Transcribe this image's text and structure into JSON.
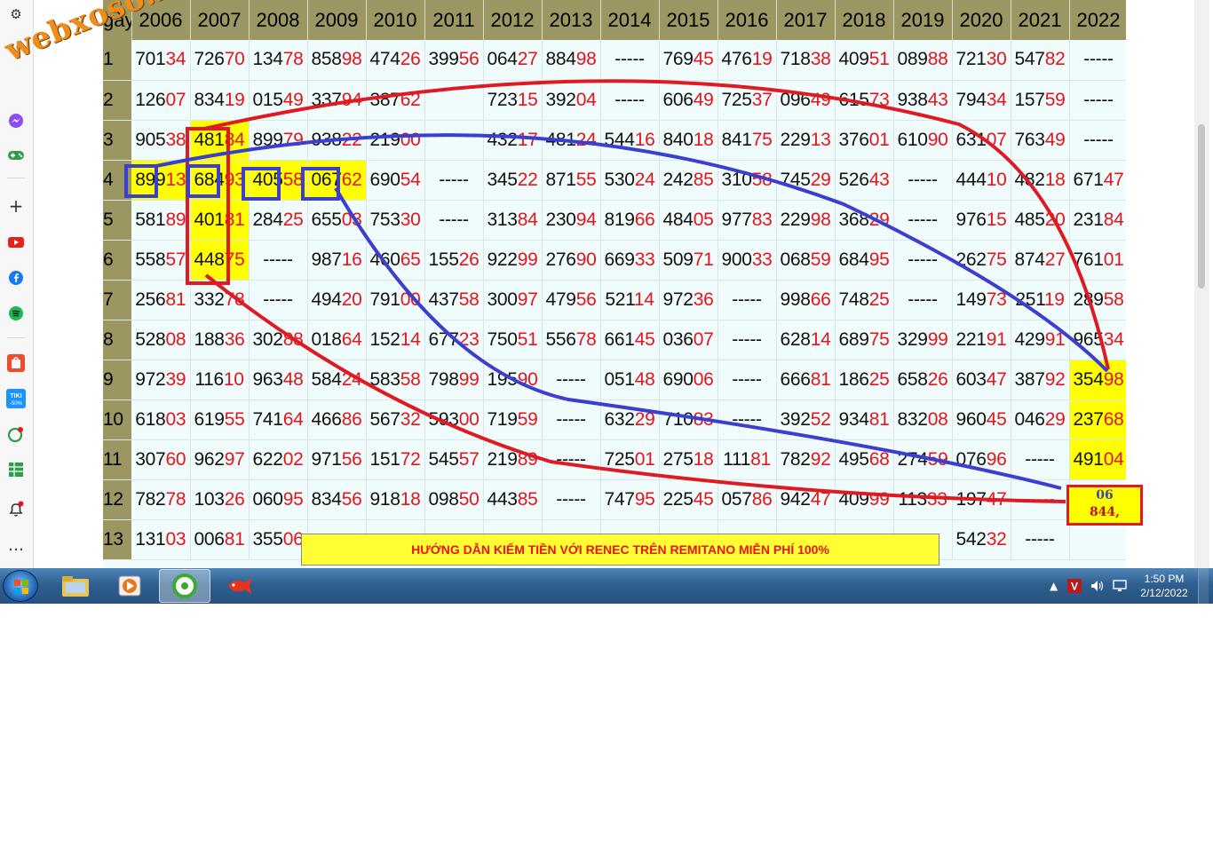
{
  "watermark": "webxoso.net",
  "header": {
    "day_label": "gày",
    "years": [
      "2006",
      "2007",
      "2008",
      "2009",
      "2010",
      "2011",
      "2012",
      "2013",
      "2014",
      "2015",
      "2016",
      "2017",
      "2018",
      "2019",
      "2020",
      "2021",
      "2022"
    ]
  },
  "rows": [
    {
      "day": "1",
      "cells": [
        [
          "701",
          "34"
        ],
        [
          "726",
          "70"
        ],
        [
          "134",
          "78"
        ],
        [
          "858",
          "98"
        ],
        [
          "474",
          "26"
        ],
        [
          "399",
          "56"
        ],
        [
          "064",
          "27"
        ],
        [
          "884",
          "98"
        ],
        [
          "-----",
          ""
        ],
        [
          "769",
          "45"
        ],
        [
          "476",
          "19"
        ],
        [
          "718",
          "38"
        ],
        [
          "409",
          "51"
        ],
        [
          "089",
          "88"
        ],
        [
          "721",
          "30"
        ],
        [
          "547",
          "82"
        ],
        [
          "-----",
          ""
        ]
      ]
    },
    {
      "day": "2",
      "cells": [
        [
          "126",
          "07"
        ],
        [
          "834",
          "19"
        ],
        [
          "015",
          "49"
        ],
        [
          "337",
          "94"
        ],
        [
          "387",
          "62"
        ],
        [
          "",
          ""
        ],
        [
          "723",
          "15"
        ],
        [
          "392",
          "04"
        ],
        [
          "-----",
          ""
        ],
        [
          "606",
          "49"
        ],
        [
          "725",
          "37"
        ],
        [
          "096",
          "49"
        ],
        [
          "615",
          "73"
        ],
        [
          "938",
          "43"
        ],
        [
          "794",
          "34"
        ],
        [
          "157",
          "59"
        ],
        [
          "-----",
          ""
        ]
      ]
    },
    {
      "day": "3",
      "cells": [
        [
          "905",
          "38"
        ],
        [
          "481",
          "84"
        ],
        [
          "899",
          "79"
        ],
        [
          "938",
          "22"
        ],
        [
          "219",
          "00"
        ],
        [
          "",
          ""
        ],
        [
          "432",
          "17"
        ],
        [
          "481",
          "24"
        ],
        [
          "544",
          "16"
        ],
        [
          "840",
          "18"
        ],
        [
          "841",
          "75"
        ],
        [
          "229",
          "13"
        ],
        [
          "376",
          "01"
        ],
        [
          "610",
          "90"
        ],
        [
          "631",
          "07"
        ],
        [
          "763",
          "49"
        ],
        [
          "-----",
          ""
        ]
      ]
    },
    {
      "day": "4",
      "cells": [
        [
          "899",
          "13"
        ],
        [
          "684",
          "93"
        ],
        [
          "405",
          "58"
        ],
        [
          "067",
          "62"
        ],
        [
          "690",
          "54"
        ],
        [
          "-----",
          ""
        ],
        [
          "345",
          "22"
        ],
        [
          "871",
          "55"
        ],
        [
          "530",
          "24"
        ],
        [
          "242",
          "85"
        ],
        [
          "310",
          "58"
        ],
        [
          "745",
          "29"
        ],
        [
          "526",
          "43"
        ],
        [
          "-----",
          ""
        ],
        [
          "444",
          "10"
        ],
        [
          "482",
          "18"
        ],
        [
          "671",
          "47"
        ]
      ]
    },
    {
      "day": "5",
      "cells": [
        [
          "581",
          "89"
        ],
        [
          "401",
          "81"
        ],
        [
          "284",
          "25"
        ],
        [
          "655",
          "03"
        ],
        [
          "753",
          "30"
        ],
        [
          "-----",
          ""
        ],
        [
          "313",
          "84"
        ],
        [
          "230",
          "94"
        ],
        [
          "819",
          "66"
        ],
        [
          "484",
          "05"
        ],
        [
          "977",
          "83"
        ],
        [
          "229",
          "98"
        ],
        [
          "368",
          "29"
        ],
        [
          "-----",
          ""
        ],
        [
          "976",
          "15"
        ],
        [
          "485",
          "20"
        ],
        [
          "231",
          "84"
        ]
      ]
    },
    {
      "day": "6",
      "cells": [
        [
          "558",
          "57"
        ],
        [
          "448",
          "75"
        ],
        [
          "-----",
          ""
        ],
        [
          "987",
          "16"
        ],
        [
          "460",
          "65"
        ],
        [
          "155",
          "26"
        ],
        [
          "922",
          "99"
        ],
        [
          "276",
          "90"
        ],
        [
          "669",
          "33"
        ],
        [
          "509",
          "71"
        ],
        [
          "900",
          "33"
        ],
        [
          "068",
          "59"
        ],
        [
          "684",
          "95"
        ],
        [
          "-----",
          ""
        ],
        [
          "262",
          "75"
        ],
        [
          "874",
          "27"
        ],
        [
          "761",
          "01"
        ]
      ]
    },
    {
      "day": "7",
      "cells": [
        [
          "256",
          "81"
        ],
        [
          "332",
          "78"
        ],
        [
          "-----",
          ""
        ],
        [
          "494",
          "20"
        ],
        [
          "791",
          "00"
        ],
        [
          "437",
          "58"
        ],
        [
          "300",
          "97"
        ],
        [
          "479",
          "56"
        ],
        [
          "521",
          "14"
        ],
        [
          "972",
          "36"
        ],
        [
          "-----",
          ""
        ],
        [
          "998",
          "66"
        ],
        [
          "748",
          "25"
        ],
        [
          "-----",
          ""
        ],
        [
          "149",
          "73"
        ],
        [
          "251",
          "19"
        ],
        [
          "289",
          "58"
        ]
      ]
    },
    {
      "day": "8",
      "cells": [
        [
          "528",
          "08"
        ],
        [
          "188",
          "36"
        ],
        [
          "302",
          "88"
        ],
        [
          "018",
          "64"
        ],
        [
          "152",
          "14"
        ],
        [
          "677",
          "23"
        ],
        [
          "750",
          "51"
        ],
        [
          "556",
          "78"
        ],
        [
          "661",
          "45"
        ],
        [
          "036",
          "07"
        ],
        [
          "-----",
          ""
        ],
        [
          "628",
          "14"
        ],
        [
          "689",
          "75"
        ],
        [
          "329",
          "99"
        ],
        [
          "221",
          "91"
        ],
        [
          "429",
          "91"
        ],
        [
          "965",
          "34"
        ]
      ]
    },
    {
      "day": "9",
      "cells": [
        [
          "972",
          "39"
        ],
        [
          "116",
          "10"
        ],
        [
          "963",
          "48"
        ],
        [
          "584",
          "24"
        ],
        [
          "583",
          "58"
        ],
        [
          "798",
          "99"
        ],
        [
          "195",
          "90"
        ],
        [
          "-----",
          ""
        ],
        [
          "051",
          "48"
        ],
        [
          "690",
          "06"
        ],
        [
          "-----",
          ""
        ],
        [
          "666",
          "81"
        ],
        [
          "186",
          "25"
        ],
        [
          "658",
          "26"
        ],
        [
          "603",
          "47"
        ],
        [
          "387",
          "92"
        ],
        [
          "354",
          "98"
        ]
      ]
    },
    {
      "day": "10",
      "cells": [
        [
          "618",
          "03"
        ],
        [
          "619",
          "55"
        ],
        [
          "741",
          "64"
        ],
        [
          "466",
          "86"
        ],
        [
          "567",
          "32"
        ],
        [
          "593",
          "00"
        ],
        [
          "719",
          "59"
        ],
        [
          "-----",
          ""
        ],
        [
          "632",
          "29"
        ],
        [
          "710",
          "83"
        ],
        [
          "-----",
          ""
        ],
        [
          "392",
          "52"
        ],
        [
          "934",
          "81"
        ],
        [
          "832",
          "08"
        ],
        [
          "960",
          "45"
        ],
        [
          "046",
          "29"
        ],
        [
          "237",
          "68"
        ]
      ]
    },
    {
      "day": "11",
      "cells": [
        [
          "307",
          "60"
        ],
        [
          "962",
          "97"
        ],
        [
          "622",
          "02"
        ],
        [
          "971",
          "56"
        ],
        [
          "151",
          "72"
        ],
        [
          "545",
          "57"
        ],
        [
          "219",
          "89"
        ],
        [
          "-----",
          ""
        ],
        [
          "725",
          "01"
        ],
        [
          "275",
          "18"
        ],
        [
          "111",
          "81"
        ],
        [
          "782",
          "92"
        ],
        [
          "495",
          "68"
        ],
        [
          "274",
          "59"
        ],
        [
          "076",
          "96"
        ],
        [
          "-----",
          ""
        ],
        [
          "491",
          "04"
        ]
      ]
    },
    {
      "day": "12",
      "cells": [
        [
          "782",
          "78"
        ],
        [
          "103",
          "26"
        ],
        [
          "060",
          "95"
        ],
        [
          "834",
          "56"
        ],
        [
          "918",
          "18"
        ],
        [
          "098",
          "50"
        ],
        [
          "443",
          "85"
        ],
        [
          "-----",
          ""
        ],
        [
          "747",
          "95"
        ],
        [
          "225",
          "45"
        ],
        [
          "057",
          "86"
        ],
        [
          "942",
          "47"
        ],
        [
          "409",
          "99"
        ],
        [
          "113",
          "33"
        ],
        [
          "197",
          "47"
        ],
        [
          "-----",
          ""
        ],
        [
          "",
          ""
        ]
      ]
    },
    {
      "day": "13",
      "cells": [
        [
          "131",
          "03"
        ],
        [
          "006",
          "81"
        ],
        [
          "355",
          "06"
        ],
        [
          "",
          ""
        ],
        [
          "",
          ""
        ],
        [
          "",
          ""
        ],
        [
          "",
          ""
        ],
        [
          "",
          ""
        ],
        [
          "",
          ""
        ],
        [
          "",
          ""
        ],
        [
          "",
          ""
        ],
        [
          "",
          ""
        ],
        [
          "",
          ""
        ],
        [
          "",
          ""
        ],
        [
          "542",
          "32"
        ],
        [
          "-----",
          ""
        ],
        [
          "",
          ""
        ]
      ]
    }
  ],
  "highlights": {
    "yellow_cells": [
      "3-1",
      "4-0",
      "4-1",
      "4-2",
      "4-3",
      "5-1",
      "6-1",
      "9-16",
      "10-16",
      "11-16"
    ]
  },
  "note_box": {
    "line1": "06",
    "line2": "844,"
  },
  "banner": "HƯỚNG DẪN KIẾM TIỀN VỚI RENEC TRÊN REMITANO MIỄN PHÍ 100%",
  "taskbar": {
    "time": "1:50 PM",
    "date": "2/12/2022"
  },
  "colors": {
    "header_bg": "#9b9762",
    "highlight": "#ffff00",
    "red_text": "#e8141b",
    "annotation_red": "#e01a22",
    "annotation_blue": "#3a3fcf"
  },
  "sidebar_icons": [
    "gear-icon",
    "history-icon",
    "messenger-icon",
    "gamepad-icon",
    "add-icon",
    "youtube-icon",
    "facebook-icon",
    "spotify-icon",
    "shopee-icon",
    "tiki-icon",
    "connect-icon",
    "table-app-icon",
    "bell-icon",
    "more-icon"
  ]
}
